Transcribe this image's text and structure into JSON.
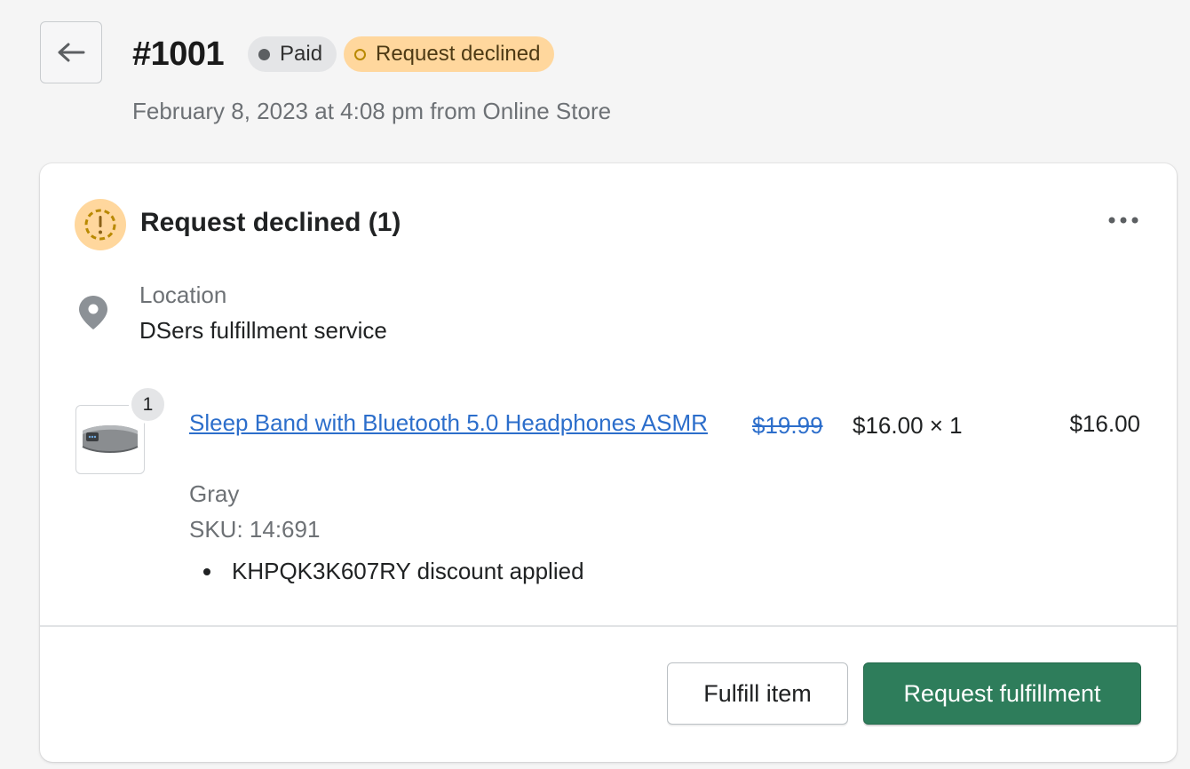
{
  "header": {
    "back_icon": "arrow-left-icon",
    "order_number": "#1001",
    "badges": {
      "paid": "Paid",
      "declined": "Request declined"
    },
    "meta": "February 8, 2023 at 4:08 pm from Online Store"
  },
  "card": {
    "status_icon": "alert-circle-icon",
    "title": "Request declined (1)",
    "more_icon": "more-horizontal-icon",
    "location": {
      "label": "Location",
      "value": "DSers fulfillment service",
      "icon": "location-pin-icon"
    },
    "line_item": {
      "quantity_badge": "1",
      "thumbnail_icon": "headband-image",
      "title": "Sleep Band with Bluetooth 5.0 Headphones ASMR",
      "variant": "Gray",
      "sku": "SKU: 14:691",
      "discount": "KHPQK3K607RY discount applied",
      "original_price": "$19.99",
      "unit_price": "$16.00 × 1",
      "total": "$16.00"
    },
    "actions": {
      "fulfill_item": "Fulfill item",
      "request_fulfillment": "Request fulfillment"
    }
  },
  "colors": {
    "primary_button": "#2e7d5b",
    "declined_badge": "#ffd79d",
    "paid_badge": "#e4e5e7",
    "link": "#2c6ecb"
  }
}
